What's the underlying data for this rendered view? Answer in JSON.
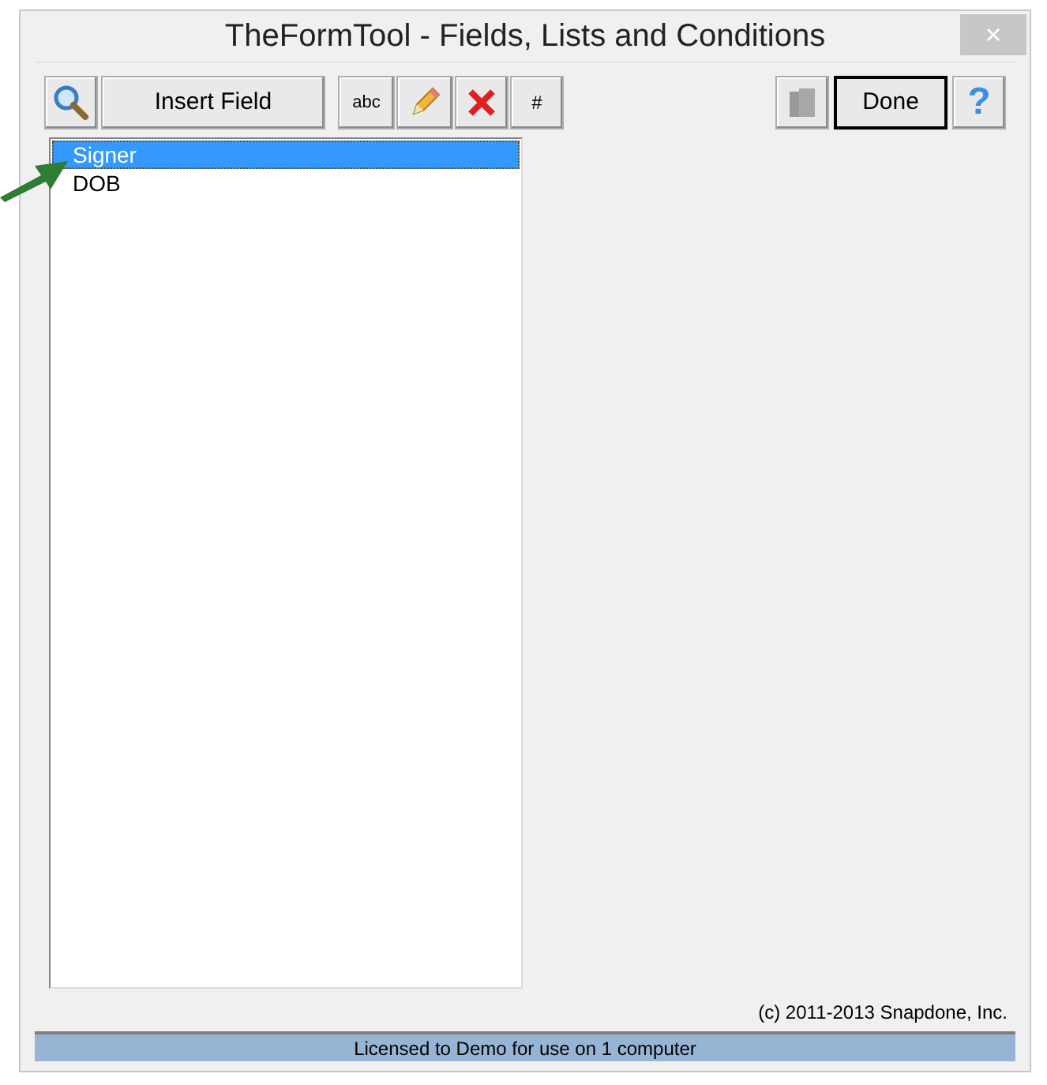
{
  "window": {
    "title": "TheFormTool - Fields, Lists and Conditions",
    "close": "×"
  },
  "toolbar": {
    "insert_field": "Insert Field",
    "abc": "abc",
    "number": "#",
    "done": "Done",
    "help": "?"
  },
  "list": {
    "items": [
      {
        "label": "Signer",
        "selected": true
      },
      {
        "label": "DOB",
        "selected": false
      }
    ]
  },
  "copyright": "(c) 2011-2013 Snapdone, Inc.",
  "status_bar": "Licensed to Demo for use on 1 computer"
}
